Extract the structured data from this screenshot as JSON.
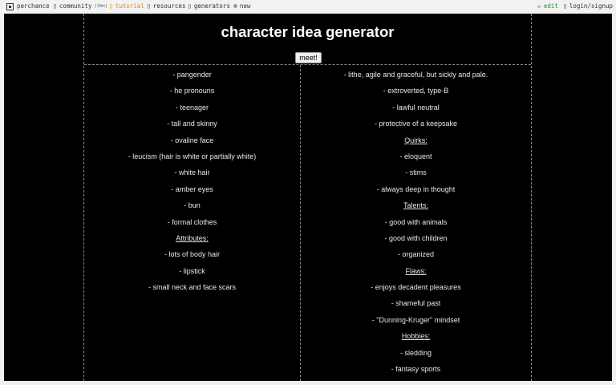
{
  "nav": {
    "brand": "perchance",
    "community": "community",
    "community_badge": "[30m]",
    "tutorial": "tutorial",
    "resources": "resources",
    "generators": "generators",
    "new": "new",
    "edit": "edit",
    "login": "login/signup",
    "icons": {
      "brand": "dice-icon",
      "community": "chat-icon",
      "tutorial": "book-icon",
      "resources": "link-icon",
      "generators": "list-icon",
      "new": "plus-circle-icon",
      "edit": "pencil-icon",
      "login": "user-icon"
    },
    "colors": {
      "tutorial": "#d98a1f",
      "edit": "#2a8a2a"
    }
  },
  "page": {
    "title": "character idea generator",
    "button_label": "meet!",
    "background": "#000000",
    "text_color": "#e8e8e8"
  },
  "left_items": [
    {
      "text": "- pangender",
      "heading": false
    },
    {
      "text": "- he pronouns",
      "heading": false
    },
    {
      "text": "- teenager",
      "heading": false
    },
    {
      "text": "- tall and skinny",
      "heading": false
    },
    {
      "text": "- ovaline face",
      "heading": false
    },
    {
      "text": "- leucism (hair is white or partially white)",
      "heading": false
    },
    {
      "text": "- white hair",
      "heading": false
    },
    {
      "text": "- amber eyes",
      "heading": false
    },
    {
      "text": "- bun",
      "heading": false
    },
    {
      "text": "- formal clothes",
      "heading": false
    },
    {
      "text": "Attributes:",
      "heading": true
    },
    {
      "text": "- lots of body hair",
      "heading": false
    },
    {
      "text": "- lipstick",
      "heading": false
    },
    {
      "text": "- small neck and face scars",
      "heading": false
    }
  ],
  "right_items": [
    {
      "text": "- lithe, agile and graceful, but sickly and pale.",
      "heading": false
    },
    {
      "text": "- extroverted, type-B",
      "heading": false
    },
    {
      "text": "- lawful neutral",
      "heading": false
    },
    {
      "text": "- protective of a keepsake",
      "heading": false
    },
    {
      "text": "Quirks:",
      "heading": true
    },
    {
      "text": "- eloquent",
      "heading": false
    },
    {
      "text": "- stims",
      "heading": false
    },
    {
      "text": "- always deep in thought",
      "heading": false
    },
    {
      "text": "Talents:",
      "heading": true
    },
    {
      "text": "- good with animals",
      "heading": false
    },
    {
      "text": "- good with children",
      "heading": false
    },
    {
      "text": "- organized",
      "heading": false
    },
    {
      "text": "Flaws:",
      "heading": true
    },
    {
      "text": "- enjoys decadent pleasures",
      "heading": false
    },
    {
      "text": "- shameful past",
      "heading": false
    },
    {
      "text": "- \"Dunning-Kruger\" mindset",
      "heading": false
    },
    {
      "text": "Hobbies:",
      "heading": true
    },
    {
      "text": "- sledding",
      "heading": false
    },
    {
      "text": "- fantasy sports",
      "heading": false
    }
  ]
}
